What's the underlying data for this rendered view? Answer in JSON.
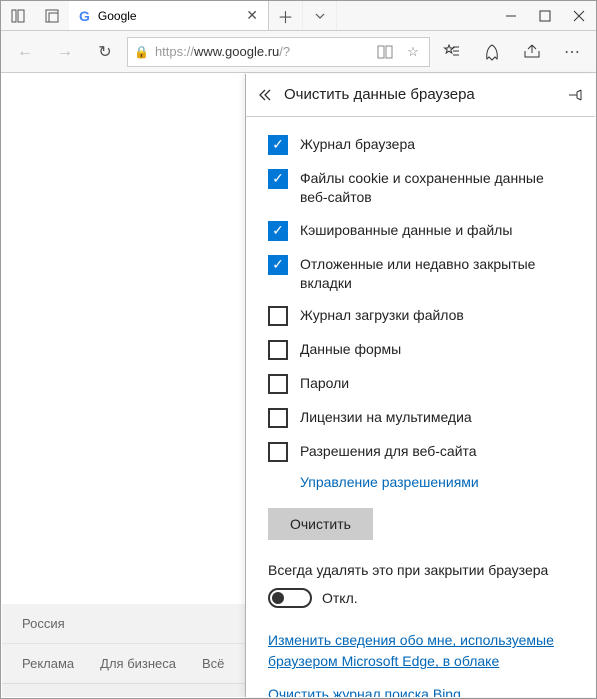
{
  "tab": {
    "title": "Google",
    "favicon": "G"
  },
  "address": {
    "scheme": "https://",
    "host": "www.google.ru",
    "path": "/?"
  },
  "panel": {
    "title": "Очистить данные браузера",
    "items": [
      {
        "label": "Журнал браузера",
        "checked": true
      },
      {
        "label": "Файлы cookie и сохраненные данные веб-сайтов",
        "checked": true
      },
      {
        "label": "Кэшированные данные и файлы",
        "checked": true
      },
      {
        "label": "Отложенные или недавно закрытые вкладки",
        "checked": true
      },
      {
        "label": "Журнал загрузки файлов",
        "checked": false
      },
      {
        "label": "Данные формы",
        "checked": false
      },
      {
        "label": "Пароли",
        "checked": false
      },
      {
        "label": "Лицензии на мультимедиа",
        "checked": false
      },
      {
        "label": "Разрешения для веб-сайта",
        "checked": false
      }
    ],
    "manage_link": "Управление разрешениями",
    "clear_button": "Очистить",
    "always_label": "Всегда удалять это при закрытии браузера",
    "toggle_state": "Откл.",
    "cloud_link": "Изменить сведения обо мне, используемые браузером Microsoft Edge, в облаке",
    "bing_link": "Очистить журнал поиска Bing"
  },
  "footer": {
    "country": "Россия",
    "links": [
      "Реклама",
      "Для бизнеса",
      "Всё"
    ]
  }
}
